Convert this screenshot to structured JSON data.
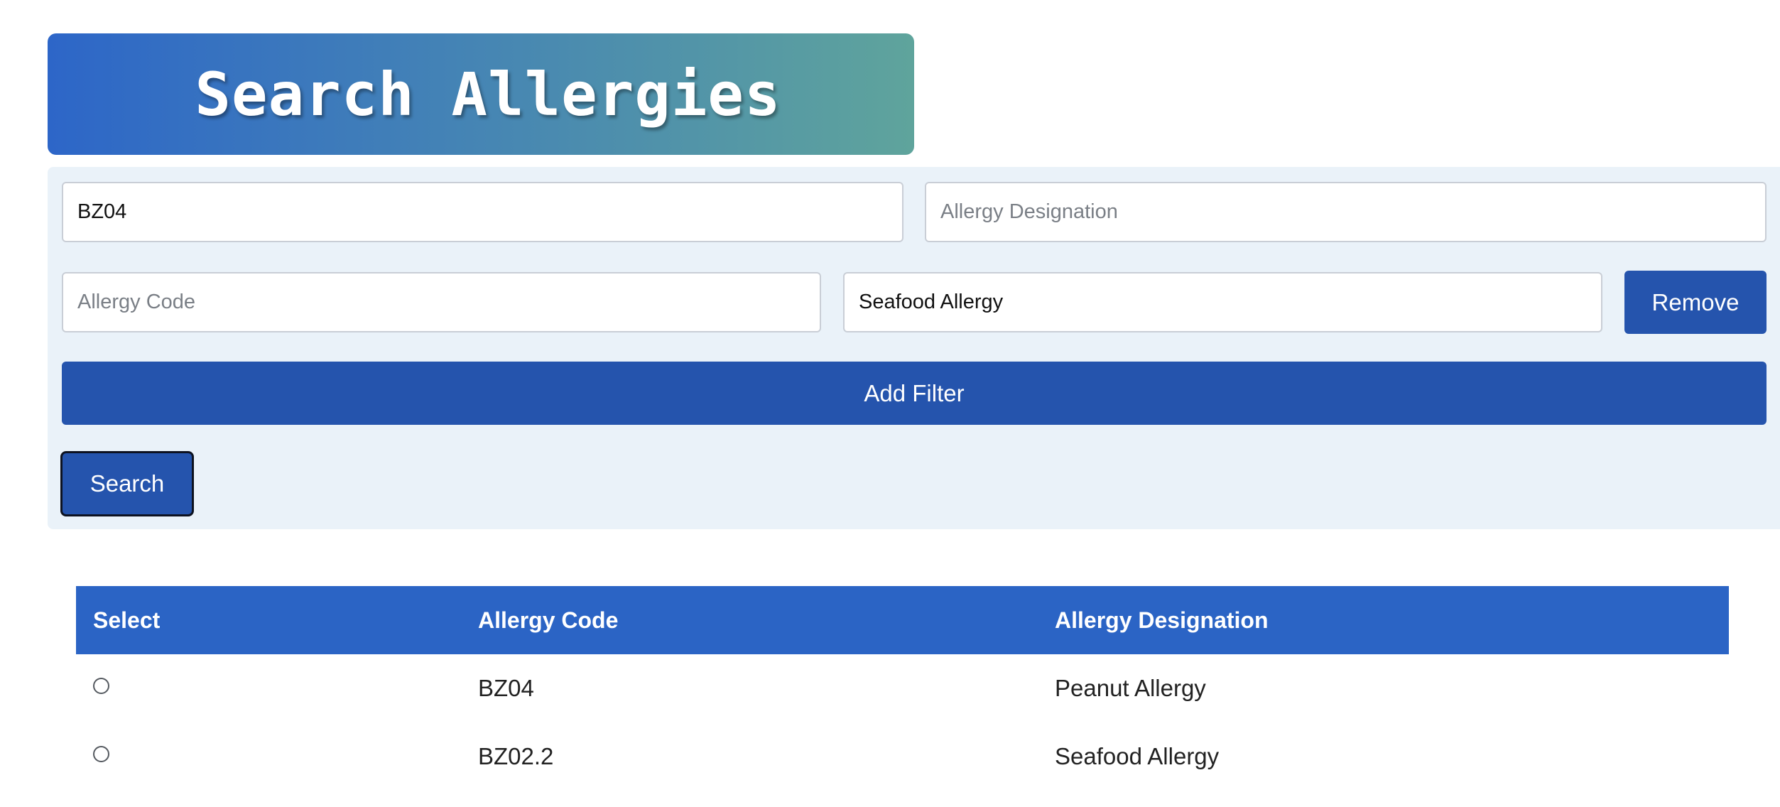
{
  "header": {
    "title": "Search Allergies"
  },
  "filters": {
    "row1": {
      "left_value": "BZ04",
      "right_placeholder": "Allergy Designation"
    },
    "row2": {
      "code_placeholder": "Allergy Code",
      "designation_value": "Seafood Allergy",
      "remove_label": "Remove"
    },
    "add_filter_label": "Add Filter",
    "search_label": "Search"
  },
  "results": {
    "columns": [
      "Select",
      "Allergy Code",
      "Allergy Designation"
    ],
    "rows": [
      {
        "code": "BZ04",
        "designation": "Peanut Allergy"
      },
      {
        "code": "BZ02.2",
        "designation": "Seafood Allergy"
      }
    ]
  },
  "colors": {
    "primary_button": "#2554ad",
    "table_header": "#2b64c5",
    "panel_background": "#eaf2f9"
  }
}
